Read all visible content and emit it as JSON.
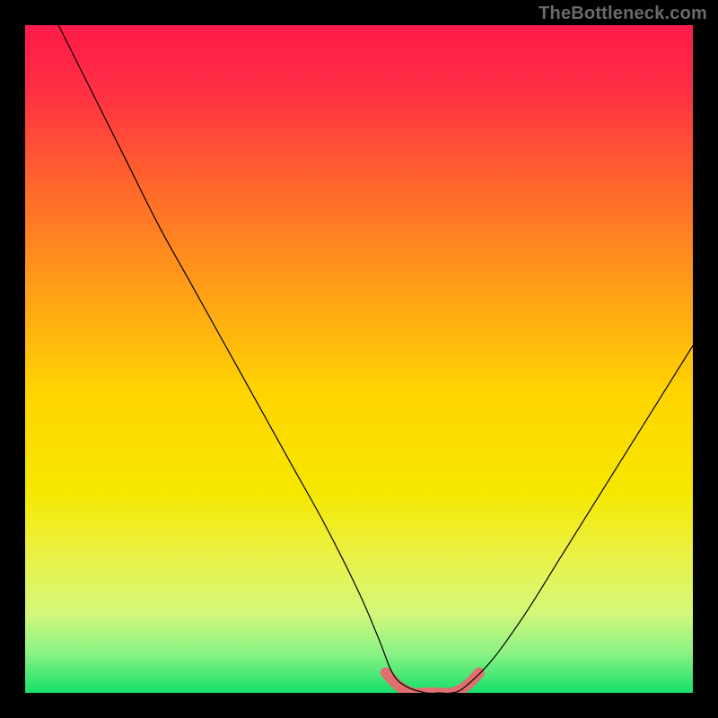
{
  "watermark": "TheBottleneck.com",
  "chart_data": {
    "type": "line",
    "title": "",
    "xlabel": "",
    "ylabel": "",
    "xlim": [
      0,
      100
    ],
    "ylim": [
      0,
      100
    ],
    "grid": false,
    "legend": false,
    "series": [
      {
        "name": "main-curve",
        "color": "#000000",
        "x": [
          5,
          10,
          15,
          20,
          25,
          30,
          35,
          40,
          45,
          50,
          53,
          55,
          57,
          60,
          62,
          64,
          66,
          70,
          75,
          80,
          85,
          90,
          95,
          100
        ],
        "y": [
          100,
          90,
          80,
          70,
          61,
          52,
          43,
          34,
          25,
          15,
          8,
          3,
          1,
          0,
          0,
          0,
          1,
          5,
          12,
          20,
          28,
          36,
          44,
          52
        ]
      },
      {
        "name": "valley-highlight",
        "color": "#e16f6f",
        "x": [
          54,
          56,
          58,
          60,
          62,
          64,
          66,
          68
        ],
        "y": [
          3,
          1,
          0,
          0,
          0,
          0,
          1,
          3
        ]
      }
    ],
    "gradient_stops": [
      {
        "offset": 0.0,
        "color": "#ff1a4a"
      },
      {
        "offset": 0.1,
        "color": "#ff3044"
      },
      {
        "offset": 0.25,
        "color": "#ff6a2a"
      },
      {
        "offset": 0.4,
        "color": "#ffa017"
      },
      {
        "offset": 0.55,
        "color": "#ffd400"
      },
      {
        "offset": 0.7,
        "color": "#f6e800"
      },
      {
        "offset": 0.8,
        "color": "#e9f24a"
      },
      {
        "offset": 0.88,
        "color": "#d4f77a"
      },
      {
        "offset": 0.94,
        "color": "#8cf285"
      },
      {
        "offset": 1.0,
        "color": "#14e06a"
      }
    ]
  }
}
